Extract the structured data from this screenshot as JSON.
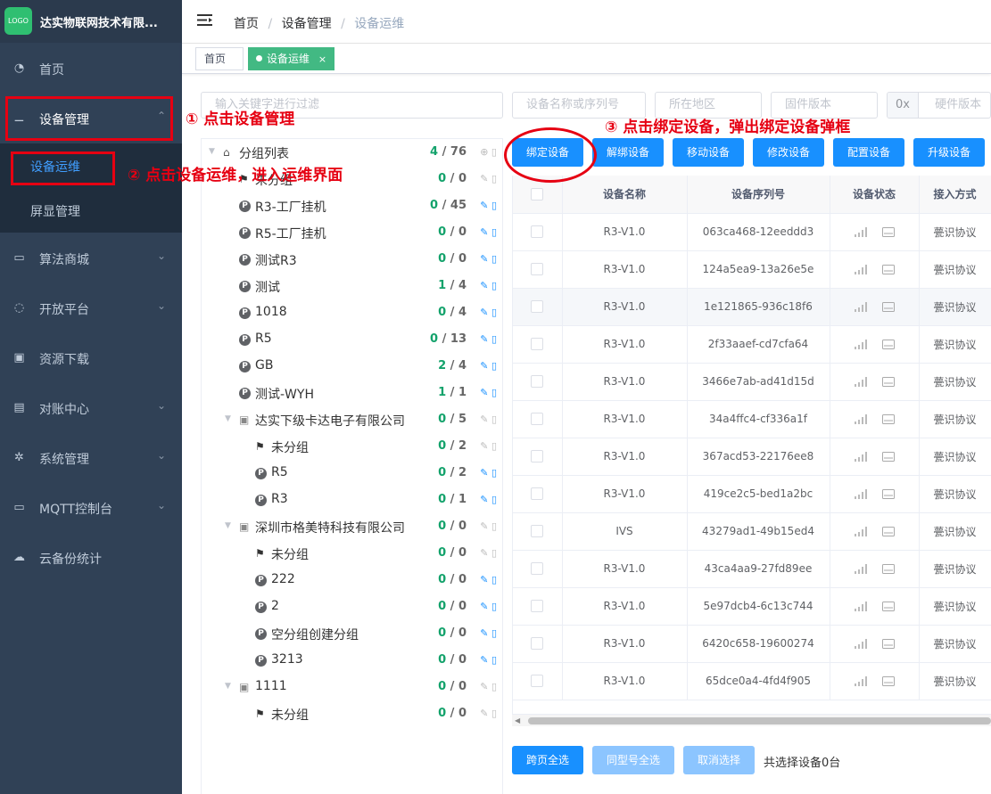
{
  "app": {
    "logo_text": "LOGO",
    "company_name": "达实物联网技术有限..."
  },
  "sidebar": {
    "items": [
      {
        "label": "首页",
        "icon": "dashboard-icon",
        "arrow": ""
      },
      {
        "label": "设备管理",
        "icon": "camera-icon",
        "arrow": "⌃"
      },
      {
        "label": "算法商城",
        "icon": "store-icon",
        "arrow": "⌄"
      },
      {
        "label": "开放平台",
        "icon": "platform-icon",
        "arrow": "⌄"
      },
      {
        "label": "资源下载",
        "icon": "download-icon",
        "arrow": ""
      },
      {
        "label": "对账中心",
        "icon": "bill-icon",
        "arrow": "⌄"
      },
      {
        "label": "系统管理",
        "icon": "gear-icon",
        "arrow": "⌄"
      },
      {
        "label": "MQTT控制台",
        "icon": "monitor-icon",
        "arrow": "⌄"
      },
      {
        "label": "云备份统计",
        "icon": "cloud-icon",
        "arrow": ""
      }
    ],
    "sub_items": [
      {
        "label": "设备运维"
      },
      {
        "label": "屏显管理"
      }
    ]
  },
  "header": {
    "breadcrumb": [
      "首页",
      "/",
      "设备管理",
      "/",
      "设备运维"
    ]
  },
  "tags": [
    {
      "label": "首页"
    },
    {
      "label": "设备运维",
      "close": "×"
    }
  ],
  "filters": {
    "keyword_placeholder": "输入关键字进行过滤",
    "device_placeholder": "设备名称或序列号",
    "region_placeholder": "所在地区",
    "firmware_placeholder": "固件版本",
    "hw_prefix": "0x",
    "hardware_placeholder": "硬件版本"
  },
  "actions": [
    "绑定设备",
    "解绑设备",
    "移动设备",
    "修改设备",
    "配置设备",
    "升级设备"
  ],
  "tree": {
    "root": {
      "label": "分组列表",
      "online": "4",
      "sep": " / ",
      "total": "76"
    },
    "nodes": [
      {
        "label": "未分组",
        "online": "0",
        "total": "0",
        "type": "flag",
        "level": 1
      },
      {
        "label": "R3-工厂挂机",
        "online": "0",
        "total": "45",
        "type": "p",
        "level": 1
      },
      {
        "label": "R5-工厂挂机",
        "online": "0",
        "total": "0",
        "type": "p",
        "level": 1
      },
      {
        "label": "测试R3",
        "online": "0",
        "total": "0",
        "type": "p",
        "level": 1
      },
      {
        "label": "测试",
        "online": "1",
        "total": "4",
        "type": "p",
        "level": 1
      },
      {
        "label": "1018",
        "online": "0",
        "total": "4",
        "type": "p",
        "level": 1
      },
      {
        "label": "R5",
        "online": "0",
        "total": "13",
        "type": "p",
        "level": 1
      },
      {
        "label": "GB",
        "online": "2",
        "total": "4",
        "type": "p",
        "level": 1
      },
      {
        "label": "测试-WYH",
        "online": "1",
        "total": "1",
        "type": "p",
        "level": 1
      },
      {
        "label": "达实下级卡达电子有限公司",
        "online": "0",
        "total": "5",
        "type": "org",
        "level": 1
      },
      {
        "label": "未分组",
        "online": "0",
        "total": "2",
        "type": "flag",
        "level": 2
      },
      {
        "label": "R5",
        "online": "0",
        "total": "2",
        "type": "p",
        "level": 2
      },
      {
        "label": "R3",
        "online": "0",
        "total": "1",
        "type": "p",
        "level": 2
      },
      {
        "label": "深圳市格美特科技有限公司",
        "online": "0",
        "total": "0",
        "type": "org",
        "level": 1
      },
      {
        "label": "未分组",
        "online": "0",
        "total": "0",
        "type": "flag",
        "level": 2
      },
      {
        "label": "222",
        "online": "0",
        "total": "0",
        "type": "p",
        "level": 2
      },
      {
        "label": "2",
        "online": "0",
        "total": "0",
        "type": "p",
        "level": 2
      },
      {
        "label": "空分组创建分组",
        "online": "0",
        "total": "0",
        "type": "p",
        "level": 2
      },
      {
        "label": "3213",
        "online": "0",
        "total": "0",
        "type": "p",
        "level": 2
      },
      {
        "label": "1111",
        "online": "0",
        "total": "0",
        "type": "org",
        "level": 1
      },
      {
        "label": "未分组",
        "online": "0",
        "total": "0",
        "type": "flag",
        "level": 2
      }
    ]
  },
  "table": {
    "columns": [
      "设备名称",
      "设备序列号",
      "设备状态",
      "接入方式"
    ],
    "rows": [
      {
        "name": "R3-V1.0",
        "serial": "063ca468-12eeddd3",
        "access": "甍识协议"
      },
      {
        "name": "R3-V1.0",
        "serial": "124a5ea9-13a26e5e",
        "access": "甍识协议"
      },
      {
        "name": "R3-V1.0",
        "serial": "1e121865-936c18f6",
        "access": "甍识协议"
      },
      {
        "name": "R3-V1.0",
        "serial": "2f33aaef-cd7cfa64",
        "access": "甍识协议"
      },
      {
        "name": "R3-V1.0",
        "serial": "3466e7ab-ad41d15d",
        "access": "甍识协议"
      },
      {
        "name": "R3-V1.0",
        "serial": "34a4ffc4-cf336a1f",
        "access": "甍识协议"
      },
      {
        "name": "R3-V1.0",
        "serial": "367acd53-22176ee8",
        "access": "甍识协议"
      },
      {
        "name": "R3-V1.0",
        "serial": "419ce2c5-bed1a2bc",
        "access": "甍识协议"
      },
      {
        "name": "IVS",
        "serial": "43279ad1-49b15ed4",
        "access": "甍识协议"
      },
      {
        "name": "R3-V1.0",
        "serial": "43ca4aa9-27fd89ee",
        "access": "甍识协议"
      },
      {
        "name": "R3-V1.0",
        "serial": "5e97dcb4-6c13c744",
        "access": "甍识协议"
      },
      {
        "name": "R3-V1.0",
        "serial": "6420c658-19600274",
        "access": "甍识协议"
      },
      {
        "name": "R3-V1.0",
        "serial": "65dce0a4-4fd4f905",
        "access": "甍识协议"
      }
    ]
  },
  "footer": {
    "select_all_pages": "跨页全选",
    "select_same_model": "同型号全选",
    "cancel_selection": "取消选择",
    "selected_count": "共选择设备0台"
  },
  "annotations": {
    "step1": "① 点击设备管理",
    "step2": "② 点击设备运维，进入运维界面",
    "step3": "③ 点击绑定设备，弹出绑定设备弹框"
  },
  "colors": {
    "primary": "#1890ff",
    "success": "#13a26b",
    "annotation": "#e60012",
    "sidebar": "#304156"
  }
}
